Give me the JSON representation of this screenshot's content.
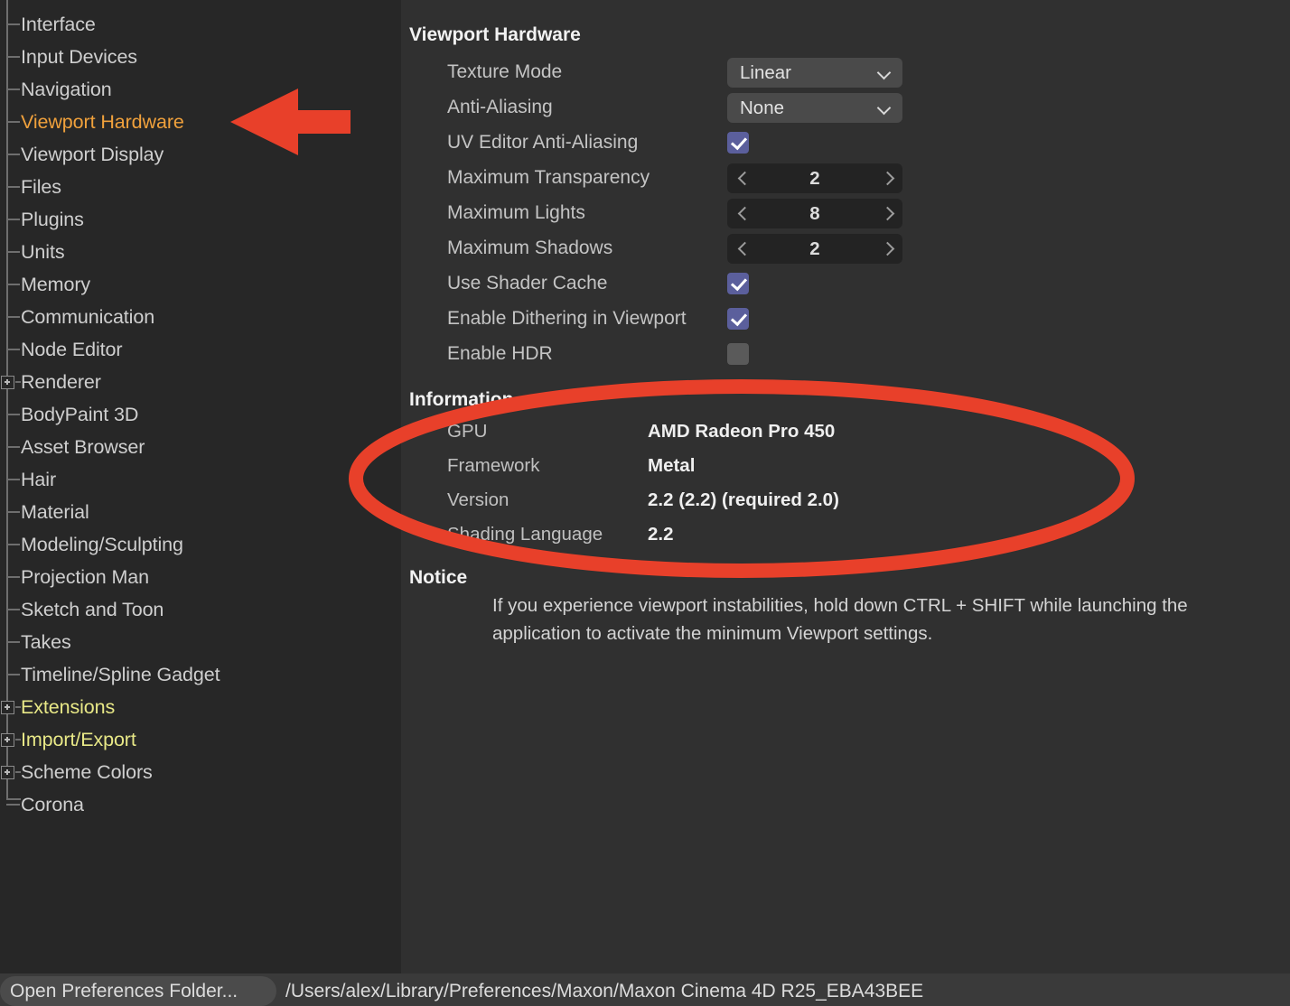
{
  "sidebar": {
    "items": [
      {
        "label": "Interface",
        "expandable": false,
        "state": "normal"
      },
      {
        "label": "Input Devices",
        "expandable": false,
        "state": "normal"
      },
      {
        "label": "Navigation",
        "expandable": false,
        "state": "normal"
      },
      {
        "label": "Viewport Hardware",
        "expandable": false,
        "state": "selected"
      },
      {
        "label": "Viewport Display",
        "expandable": false,
        "state": "normal"
      },
      {
        "label": "Files",
        "expandable": false,
        "state": "normal"
      },
      {
        "label": "Plugins",
        "expandable": false,
        "state": "normal"
      },
      {
        "label": "Units",
        "expandable": false,
        "state": "normal"
      },
      {
        "label": "Memory",
        "expandable": false,
        "state": "normal"
      },
      {
        "label": "Communication",
        "expandable": false,
        "state": "normal"
      },
      {
        "label": "Node Editor",
        "expandable": false,
        "state": "normal"
      },
      {
        "label": "Renderer",
        "expandable": true,
        "state": "normal"
      },
      {
        "label": "BodyPaint 3D",
        "expandable": false,
        "state": "normal"
      },
      {
        "label": "Asset Browser",
        "expandable": false,
        "state": "normal"
      },
      {
        "label": "Hair",
        "expandable": false,
        "state": "normal"
      },
      {
        "label": "Material",
        "expandable": false,
        "state": "normal"
      },
      {
        "label": "Modeling/Sculpting",
        "expandable": false,
        "state": "normal"
      },
      {
        "label": "Projection Man",
        "expandable": false,
        "state": "normal"
      },
      {
        "label": "Sketch and Toon",
        "expandable": false,
        "state": "normal"
      },
      {
        "label": "Takes",
        "expandable": false,
        "state": "normal"
      },
      {
        "label": "Timeline/Spline Gadget",
        "expandable": false,
        "state": "normal"
      },
      {
        "label": "Extensions",
        "expandable": true,
        "state": "extension"
      },
      {
        "label": "Import/Export",
        "expandable": true,
        "state": "extension"
      },
      {
        "label": "Scheme Colors",
        "expandable": true,
        "state": "normal"
      },
      {
        "label": "Corona",
        "expandable": false,
        "state": "normal"
      }
    ]
  },
  "main": {
    "viewport_hardware": {
      "heading": "Viewport Hardware",
      "fields": [
        {
          "label": "Texture Mode",
          "type": "dropdown",
          "value": "Linear"
        },
        {
          "label": "Anti-Aliasing",
          "type": "dropdown",
          "value": "None"
        },
        {
          "label": "UV Editor Anti-Aliasing",
          "type": "checkbox",
          "value": "checked"
        },
        {
          "label": "Maximum Transparency",
          "type": "stepper",
          "value": "2"
        },
        {
          "label": "Maximum Lights",
          "type": "stepper",
          "value": "8"
        },
        {
          "label": "Maximum Shadows",
          "type": "stepper",
          "value": "2"
        },
        {
          "label": "Use Shader Cache",
          "type": "checkbox",
          "value": "checked"
        },
        {
          "label": "Enable Dithering in Viewport",
          "type": "checkbox",
          "value": "checked"
        },
        {
          "label": "Enable HDR",
          "type": "checkbox",
          "value": "unchecked"
        }
      ]
    },
    "information": {
      "heading": "Information",
      "rows": [
        {
          "label": "GPU",
          "value": "AMD Radeon Pro 450"
        },
        {
          "label": "Framework",
          "value": "Metal"
        },
        {
          "label": "Version",
          "value": "2.2 (2.2) (required 2.0)"
        },
        {
          "label": "Shading Language",
          "value": "2.2"
        }
      ]
    },
    "notice": {
      "heading": "Notice",
      "body": "If you experience viewport instabilities, hold down CTRL + SHIFT while launching the application to activate the minimum Viewport settings."
    }
  },
  "statusbar": {
    "open_folder_label": "Open Preferences Folder...",
    "path": "/Users/alex/Library/Preferences/Maxon/Maxon Cinema 4D R25_EBA43BEE"
  },
  "annotations": {
    "arrow_color": "#e8402a",
    "ellipse_color": "#e8402a",
    "arrow_target": "Viewport Hardware",
    "ellipse_target": "Information"
  },
  "colors": {
    "sidebar_bg": "#272727",
    "panel_bg": "#303030",
    "selected_item": "#f0a13c",
    "extension_item": "#e8e887",
    "checkbox_on": "#5b5f9c",
    "statusbar_bg": "#3a3a3a"
  }
}
